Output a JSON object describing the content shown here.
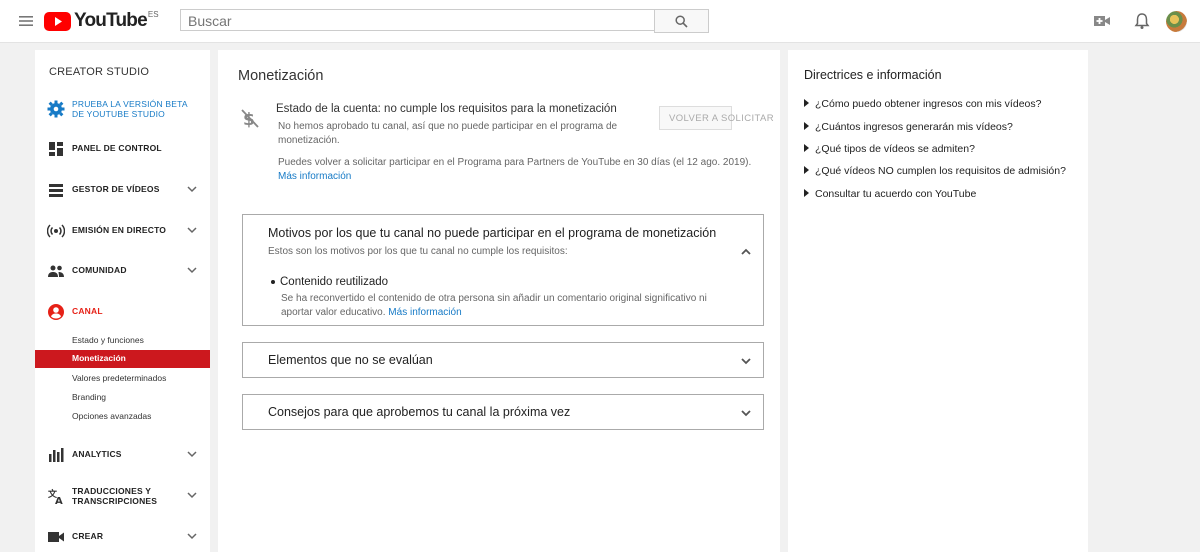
{
  "header": {
    "logo_text": "YouTube",
    "country_code": "ES",
    "search_placeholder": "Buscar"
  },
  "sidebar": {
    "title": "CREATOR STUDIO",
    "beta_label_line1": "PRUEBA LA VERSIÓN BETA",
    "beta_label_line2": "DE YOUTUBE STUDIO",
    "items": {
      "dashboard": "PANEL DE CONTROL",
      "video_manager": "GESTOR DE VÍDEOS",
      "live": "EMISIÓN EN DIRECTO",
      "community": "COMUNIDAD",
      "channel": "CANAL",
      "analytics": "ANALYTICS",
      "translations_line1": "TRADUCCIONES Y",
      "translations_line2": "TRANSCRIPCIONES",
      "create": "CREAR"
    },
    "channel_sub": {
      "status": "Estado y funciones",
      "monetization": "Monetización",
      "defaults": "Valores predeterminados",
      "branding": "Branding",
      "advanced": "Opciones avanzadas"
    }
  },
  "main": {
    "title": "Monetización",
    "status_title": "Estado de la cuenta: no cumple los requisitos para la monetización",
    "status_desc": "No hemos aprobado tu canal, así que no puede participar en el programa de monetización.",
    "reapply_text": "Puedes volver a solicitar participar en el Programa para Partners de YouTube en 30 días (el 12 ago. 2019).",
    "more_info": "Más información",
    "reapply_button": "VOLVER A SOLICITAR",
    "panels": {
      "reasons_title": "Motivos por los que tu canal no puede participar en el programa de monetización",
      "reasons_sub": "Estos son los motivos por los que tu canal no cumple los requisitos:",
      "reason_title": "Contenido reutilizado",
      "reason_desc": "Se ha reconvertido el contenido de otra persona sin añadir un comentario original significativo ni aportar valor educativo.",
      "reason_link": "Más información",
      "not_evaluated_title": "Elementos que no se evalúan",
      "tips_title": "Consejos para que aprobemos tu canal la próxima vez"
    }
  },
  "right": {
    "title": "Directrices e información",
    "links": [
      "¿Cómo puedo obtener ingresos con mis vídeos?",
      "¿Cuántos ingresos generarán mis vídeos?",
      "¿Qué tipos de vídeos se admiten?",
      "¿Qué vídeos NO cumplen los requisitos de admisión?",
      "Consultar tu acuerdo con YouTube"
    ]
  },
  "colors": {
    "brand_red": "#ff0000",
    "link_blue": "#167ac6",
    "active_red": "#cc181e"
  }
}
